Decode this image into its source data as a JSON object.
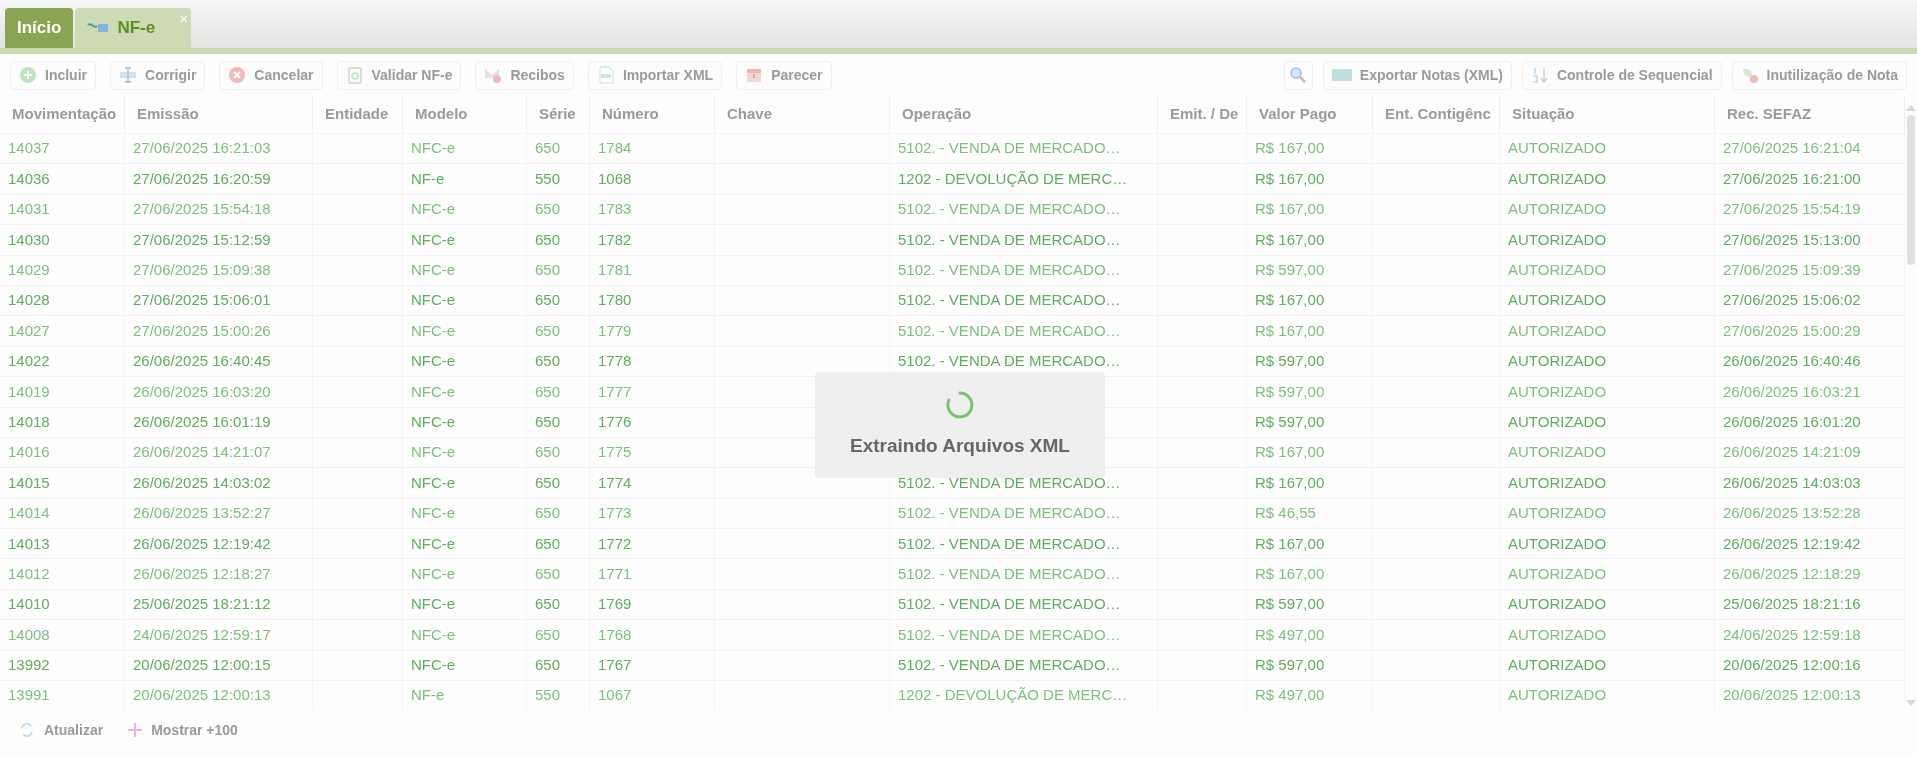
{
  "tabs": [
    {
      "label": "Início",
      "selected": false
    },
    {
      "label": "NF-e",
      "selected": true,
      "close": "×"
    }
  ],
  "toolbar_left": [
    "Incluir",
    "Corrigir",
    "Cancelar",
    "Validar NF-e",
    "Recibos",
    "Importar XML",
    "Parecer"
  ],
  "toolbar_right": [
    "Exportar Notas (XML)",
    "Controle de Sequencial",
    "Inutilização de Nota"
  ],
  "table": {
    "columns": [
      "Movimentação",
      "Emissão",
      "Entidade",
      "Modelo",
      "Série",
      "Número",
      "Chave",
      "Operação",
      "Emit. / De",
      "Valor Pago",
      "Ent. Contigênc",
      "Situação",
      "Rec. SEFAZ"
    ],
    "rows": [
      {
        "movimentacao": "14037",
        "emissao": "27/06/2025 16:21:03",
        "modelo": "NFC-e",
        "serie": "650",
        "numero": "1784",
        "operacao": "5102. - VENDA DE MERCADO…",
        "valor": "R$ 167,00",
        "situacao": "AUTORIZADO",
        "rec": "27/06/2025 16:21:04"
      },
      {
        "movimentacao": "14036",
        "emissao": "27/06/2025 16:20:59",
        "modelo": "NF-e",
        "serie": "550",
        "numero": "1068",
        "operacao": "1202 - DEVOLUÇÃO DE MERC…",
        "valor": "R$ 167,00",
        "situacao": "AUTORIZADO",
        "rec": "27/06/2025 16:21:00"
      },
      {
        "movimentacao": "14031",
        "emissao": "27/06/2025 15:54:18",
        "modelo": "NFC-e",
        "serie": "650",
        "numero": "1783",
        "operacao": "5102. - VENDA DE MERCADO…",
        "valor": "R$ 167,00",
        "situacao": "AUTORIZADO",
        "rec": "27/06/2025 15:54:19"
      },
      {
        "movimentacao": "14030",
        "emissao": "27/06/2025 15:12:59",
        "modelo": "NFC-e",
        "serie": "650",
        "numero": "1782",
        "operacao": "5102. - VENDA DE MERCADO…",
        "valor": "R$ 167,00",
        "situacao": "AUTORIZADO",
        "rec": "27/06/2025 15:13:00"
      },
      {
        "movimentacao": "14029",
        "emissao": "27/06/2025 15:09:38",
        "modelo": "NFC-e",
        "serie": "650",
        "numero": "1781",
        "operacao": "5102. - VENDA DE MERCADO…",
        "valor": "R$ 597,00",
        "situacao": "AUTORIZADO",
        "rec": "27/06/2025 15:09:39"
      },
      {
        "movimentacao": "14028",
        "emissao": "27/06/2025 15:06:01",
        "modelo": "NFC-e",
        "serie": "650",
        "numero": "1780",
        "operacao": "5102. - VENDA DE MERCADO…",
        "valor": "R$ 167,00",
        "situacao": "AUTORIZADO",
        "rec": "27/06/2025 15:06:02"
      },
      {
        "movimentacao": "14027",
        "emissao": "27/06/2025 15:00:26",
        "modelo": "NFC-e",
        "serie": "650",
        "numero": "1779",
        "operacao": "5102. - VENDA DE MERCADO…",
        "valor": "R$ 167,00",
        "situacao": "AUTORIZADO",
        "rec": "27/06/2025 15:00:29"
      },
      {
        "movimentacao": "14022",
        "emissao": "26/06/2025 16:40:45",
        "modelo": "NFC-e",
        "serie": "650",
        "numero": "1778",
        "operacao": "5102. - VENDA DE MERCADO…",
        "valor": "R$ 597,00",
        "situacao": "AUTORIZADO",
        "rec": "26/06/2025 16:40:46"
      },
      {
        "movimentacao": "14019",
        "emissao": "26/06/2025 16:03:20",
        "modelo": "NFC-e",
        "serie": "650",
        "numero": "1777",
        "valor": "R$ 597,00",
        "situacao": "AUTORIZADO",
        "rec": "26/06/2025 16:03:21"
      },
      {
        "movimentacao": "14018",
        "emissao": "26/06/2025 16:01:19",
        "modelo": "NFC-e",
        "serie": "650",
        "numero": "1776",
        "valor": "R$ 597,00",
        "situacao": "AUTORIZADO",
        "rec": "26/06/2025 16:01:20"
      },
      {
        "movimentacao": "14016",
        "emissao": "26/06/2025 14:21:07",
        "modelo": "NFC-e",
        "serie": "650",
        "numero": "1775",
        "valor": "R$ 167,00",
        "situacao": "AUTORIZADO",
        "rec": "26/06/2025 14:21:09"
      },
      {
        "movimentacao": "14015",
        "emissao": "26/06/2025 14:03:02",
        "modelo": "NFC-e",
        "serie": "650",
        "numero": "1774",
        "operacao": "5102. - VENDA DE MERCADO…",
        "valor": "R$ 167,00",
        "situacao": "AUTORIZADO",
        "rec": "26/06/2025 14:03:03"
      },
      {
        "movimentacao": "14014",
        "emissao": "26/06/2025 13:52:27",
        "modelo": "NFC-e",
        "serie": "650",
        "numero": "1773",
        "operacao": "5102. - VENDA DE MERCADO…",
        "valor": "R$ 46,55",
        "situacao": "AUTORIZADO",
        "rec": "26/06/2025 13:52:28"
      },
      {
        "movimentacao": "14013",
        "emissao": "26/06/2025 12:19:42",
        "modelo": "NFC-e",
        "serie": "650",
        "numero": "1772",
        "operacao": "5102. - VENDA DE MERCADO…",
        "valor": "R$ 167,00",
        "situacao": "AUTORIZADO",
        "rec": "26/06/2025 12:19:42"
      },
      {
        "movimentacao": "14012",
        "emissao": "26/06/2025 12:18:27",
        "modelo": "NFC-e",
        "serie": "650",
        "numero": "1771",
        "operacao": "5102. - VENDA DE MERCADO…",
        "valor": "R$ 167,00",
        "situacao": "AUTORIZADO",
        "rec": "26/06/2025 12:18:29"
      },
      {
        "movimentacao": "14010",
        "emissao": "25/06/2025 18:21:12",
        "modelo": "NFC-e",
        "serie": "650",
        "numero": "1769",
        "operacao": "5102. - VENDA DE MERCADO…",
        "valor": "R$ 597,00",
        "situacao": "AUTORIZADO",
        "rec": "25/06/2025 18:21:16"
      },
      {
        "movimentacao": "14008",
        "emissao": "24/06/2025 12:59:17",
        "modelo": "NFC-e",
        "serie": "650",
        "numero": "1768",
        "operacao": "5102. - VENDA DE MERCADO…",
        "valor": "R$ 497,00",
        "situacao": "AUTORIZADO",
        "rec": "24/06/2025 12:59:18"
      },
      {
        "movimentacao": "13992",
        "emissao": "20/06/2025 12:00:15",
        "modelo": "NFC-e",
        "serie": "650",
        "numero": "1767",
        "operacao": "5102. - VENDA DE MERCADO…",
        "valor": "R$ 597,00",
        "situacao": "AUTORIZADO",
        "rec": "20/06/2025 12:00:16"
      },
      {
        "movimentacao": "13991",
        "emissao": "20/06/2025 12:00:13",
        "modelo": "NF-e",
        "serie": "550",
        "numero": "1067",
        "operacao": "1202 - DEVOLUÇÃO DE MERC…",
        "valor": "R$ 497,00",
        "situacao": "AUTORIZADO",
        "rec": "20/06/2025 12:00:13"
      }
    ]
  },
  "footer": [
    "Atualizar",
    "Mostrar +100"
  ],
  "loading": {
    "message": "Extraindo Arquivos XML"
  }
}
